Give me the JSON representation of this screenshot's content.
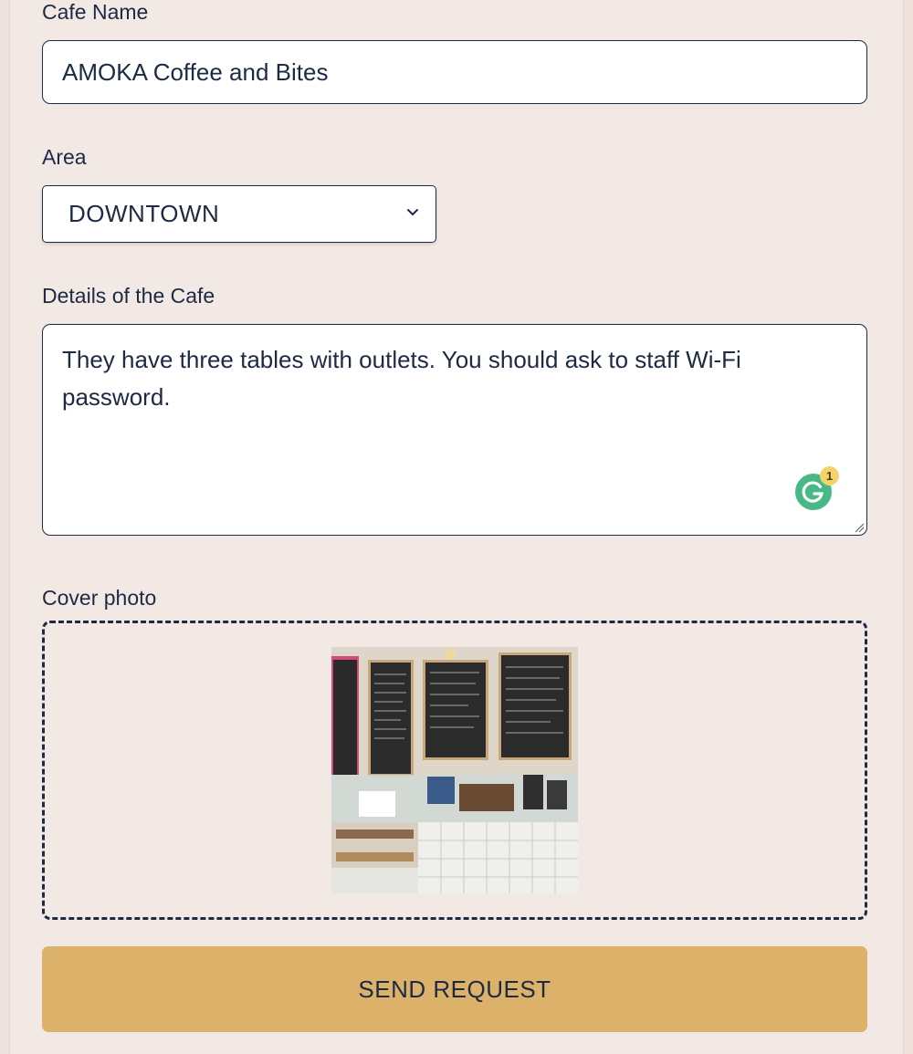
{
  "form": {
    "cafe_name": {
      "label": "Cafe Name",
      "value": "AMOKA Coffee and Bites"
    },
    "area": {
      "label": "Area",
      "selected": "DOWNTOWN"
    },
    "details": {
      "label": "Details of the Cafe",
      "value": "They have three tables with outlets. You should ask to staff Wi-Fi password."
    },
    "cover_photo": {
      "label": "Cover photo"
    },
    "grammarly": {
      "badge_count": "1"
    },
    "submit": {
      "label": "SEND REQUEST"
    }
  },
  "colors": {
    "page_background": "#f2e8e4",
    "text": "#1d2a44",
    "button": "#dcb26b",
    "grammarly": "#48b887"
  },
  "icons": [
    "chevron-down-icon",
    "resize-handle-icon",
    "grammarly-icon"
  ]
}
